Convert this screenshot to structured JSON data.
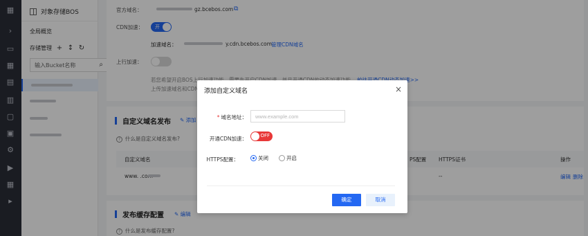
{
  "rail": {
    "icons": [
      "grid-icon",
      "chevron-right-icon",
      "monitor-icon",
      "apps-icon",
      "storage-icon",
      "database-icon",
      "document-icon",
      "building-icon",
      "network-icon",
      "video-icon",
      "calendar-icon",
      "terminal-icon"
    ]
  },
  "sidebar": {
    "title": "对象存储BOS",
    "overview": "全局概览",
    "storage_mgmt": "存储管理",
    "search_placeholder": "输入Bucket名称"
  },
  "main": {
    "official_domain_label": "官方域名：",
    "official_domain_value": "gz.bcebos.com",
    "cdn_label": "CDN加速：",
    "cdn_toggle_text": "开",
    "accel_domain_label": "加速域名：",
    "accel_domain_value": "y.cdn.bcebos.com",
    "manage_cdn_link": "管理CDN域名",
    "upload_accel_label": "上行加速：",
    "hint_line1": "若您希望开启BOS上行加速功能，需要先开启CDN加速，并且开通CDN的动态加速功能。",
    "hint_link": "前往开通CDN动态加速>>",
    "hint_line2": "上传加速域名和CDN",
    "custom_domain_title": "自定义域名发布",
    "add_link": "添加",
    "what_is_custom_domain": "什么是自定义域名发布?",
    "col_custom_domain": "自定义域名",
    "col_https_fs": "PS配置",
    "col_https_cert": "HTTPS证书",
    "col_action": "操作",
    "row_domain": "www.      .com",
    "row_dash": "--",
    "row_edit": "编辑",
    "row_delete": "删除",
    "cache_title": "发布缓存配置",
    "cache_edit": "编辑",
    "what_is_cache": "什么是发布缓存配置?"
  },
  "dialog": {
    "title": "添加自定义域名",
    "domain_label": "域名地址：",
    "domain_placeholder": "www.example.com",
    "cdn_label": "开通CDN加速：",
    "cdn_toggle_text": "OFF",
    "https_label": "HTTPS配置：",
    "https_off": "关闭",
    "https_on": "开启",
    "confirm": "确定",
    "cancel": "取消"
  }
}
